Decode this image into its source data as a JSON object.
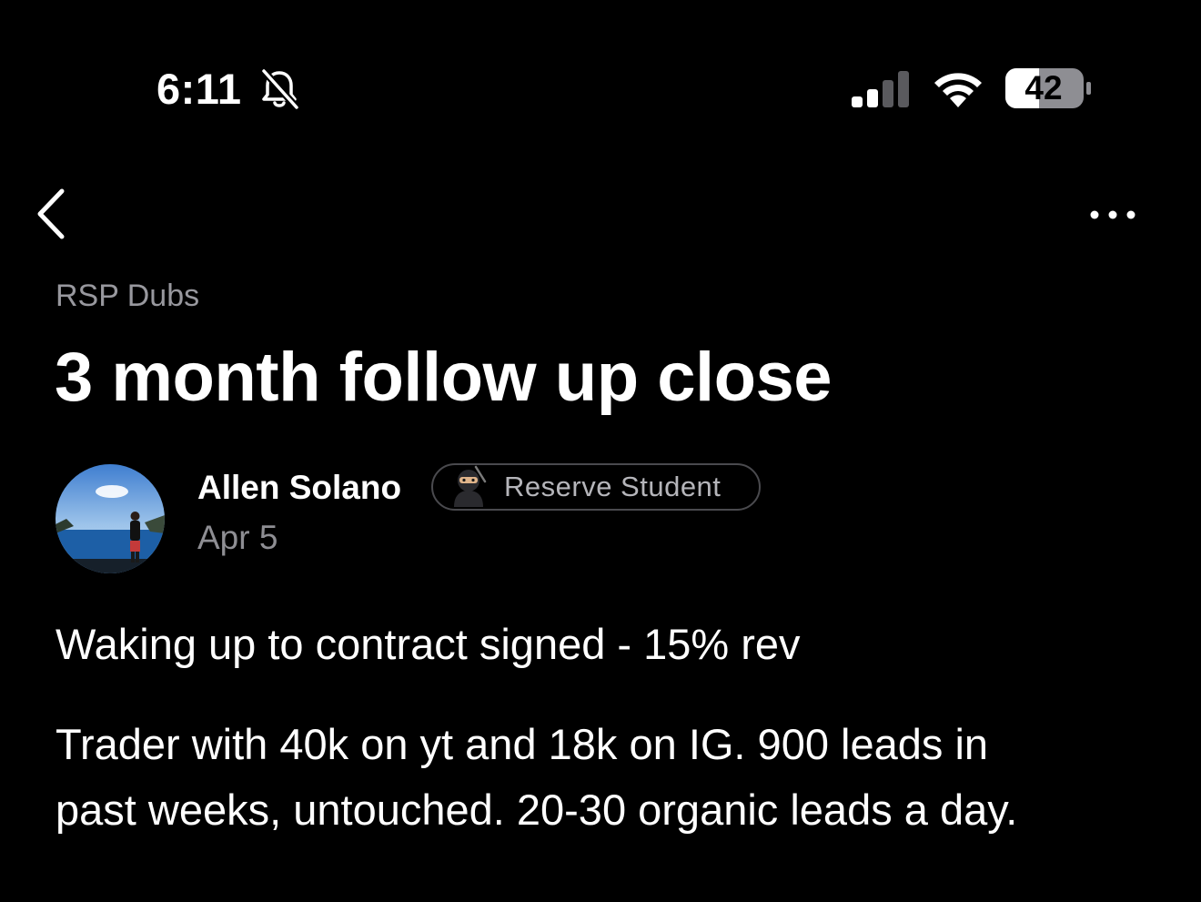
{
  "status_bar": {
    "time": "6:11",
    "battery": "42",
    "icons": [
      "bell-slash-icon",
      "cellular-signal-icon",
      "wifi-icon",
      "battery-icon"
    ]
  },
  "nav": {
    "back_icon": "chevron-left-icon",
    "more_icon": "ellipsis-icon"
  },
  "post": {
    "category": "RSP Dubs",
    "title": "3 month follow up close",
    "author": {
      "name": "Allen Solano",
      "badge": "Reserve Student",
      "badge_icon": "ninja-icon",
      "date": "Apr 5"
    },
    "body": [
      "Waking up to contract signed - 15% rev",
      "Trader with 40k on yt and 18k on IG. 900 leads in",
      "past weeks, untouched. 20-30 organic leads a day."
    ]
  },
  "colors": {
    "background": "#000000",
    "text_primary": "#ffffff",
    "text_secondary": "#98989e",
    "badge_border": "#4a4a4e"
  }
}
